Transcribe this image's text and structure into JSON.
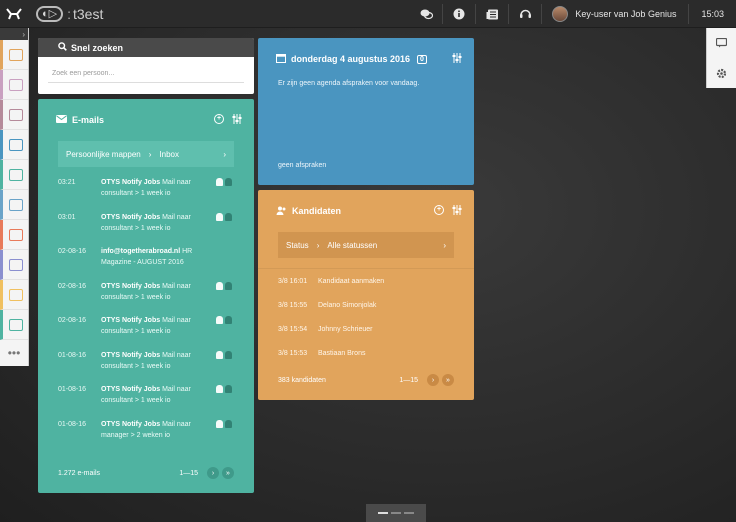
{
  "topbar": {
    "brand": "t3est",
    "user": "Key-user van Job Genius",
    "time": "15:03"
  },
  "rail": {
    "items": [
      {
        "name": "rail-candidates",
        "color": "#e1a45c"
      },
      {
        "name": "rail-companies",
        "color": "#c9a0c0"
      },
      {
        "name": "rail-contacts",
        "color": "#b58a9a"
      },
      {
        "name": "rail-agenda",
        "color": "#4a95c0"
      },
      {
        "name": "rail-emails",
        "color": "#4fb3a1"
      },
      {
        "name": "rail-documents",
        "color": "#6aa3c8"
      },
      {
        "name": "rail-reports",
        "color": "#e87a5a"
      },
      {
        "name": "rail-vacancies",
        "color": "#8a8fcf"
      },
      {
        "name": "rail-tasks",
        "color": "#f0c060"
      },
      {
        "name": "rail-notifications",
        "color": "#4fb3a1"
      }
    ],
    "more": "•••"
  },
  "search": {
    "title": "Snel zoeken",
    "placeholder": "Zoek een persoon..."
  },
  "emails": {
    "title": "E-mails",
    "crumb_folder": "Persoonlijke mappen",
    "crumb_sub": "Inbox",
    "rows": [
      {
        "date": "03:21",
        "from": "OTYS Notify Jobs",
        "text": " Mail naar consultant > 1 week io",
        "icons": true
      },
      {
        "date": "03:01",
        "from": "OTYS Notify Jobs",
        "text": " Mail naar consultant > 1 week io",
        "icons": true
      },
      {
        "date": "02-08-16",
        "from": "info@togetherabroad.nl",
        "text": " HR Magazine - AUGUST 2016",
        "icons": false
      },
      {
        "date": "02-08-16",
        "from": "OTYS Notify Jobs",
        "text": " Mail naar consultant > 1 week io",
        "icons": true
      },
      {
        "date": "02-08-16",
        "from": "OTYS Notify Jobs",
        "text": " Mail naar consultant > 1 week io",
        "icons": true
      },
      {
        "date": "01-08-16",
        "from": "OTYS Notify Jobs",
        "text": " Mail naar consultant > 1 week io",
        "icons": true
      },
      {
        "date": "01-08-16",
        "from": "OTYS Notify Jobs",
        "text": " Mail naar consultant > 1 week io",
        "icons": true
      },
      {
        "date": "01-08-16",
        "from": "OTYS Notify Jobs",
        "text": " Mail naar manager > 2 weken io",
        "icons": true
      }
    ],
    "count": "1.272 e-mails",
    "range": "1—15"
  },
  "agenda": {
    "title": "donderdag 4 augustus 2016",
    "badge": "0",
    "empty": "Er zijn geen agenda afspraken voor vandaag.",
    "link": "geen afspraken"
  },
  "candidates": {
    "title": "Kandidaten",
    "crumb_label": "Status",
    "crumb_value": "Alle statussen",
    "rows": [
      {
        "time": "3/8 16:01",
        "name": "Kandidaat aanmaken"
      },
      {
        "time": "3/8 15:55",
        "name": "Delano Simonjolak"
      },
      {
        "time": "3/8 15:54",
        "name": "Johnny Schrieuer"
      },
      {
        "time": "3/8 15:53",
        "name": "Bastiaan Brons"
      }
    ],
    "count": "383 kandidaten",
    "range": "1—15"
  }
}
